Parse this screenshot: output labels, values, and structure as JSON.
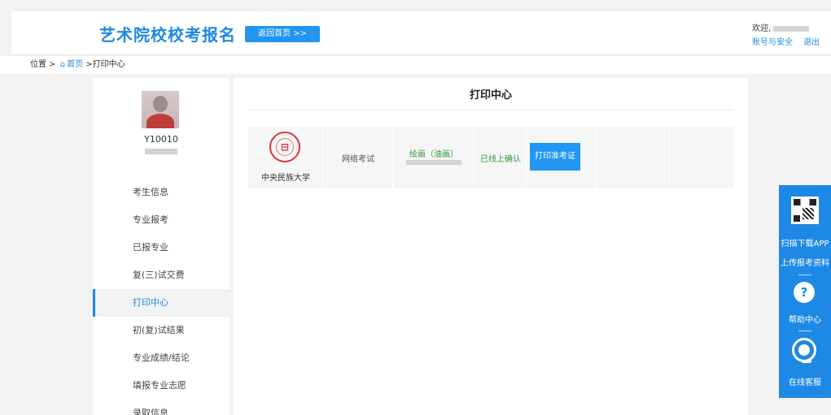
{
  "header": {
    "site_title": "艺术院校校考报名",
    "home_button": "返回首页 >>",
    "welcome": "欢迎,",
    "account_security": "账号与安全",
    "logout": "退出"
  },
  "breadcrumb": {
    "location": "位置 >",
    "home_icon": "⌂",
    "home": "首页",
    "separator": ">",
    "current": "打印中心"
  },
  "sidebar": {
    "student_id": "Y10010",
    "items": [
      {
        "label": "考生信息"
      },
      {
        "label": "专业报考"
      },
      {
        "label": "已报专业"
      },
      {
        "label": "复(三)试交费"
      },
      {
        "label": "打印中心"
      },
      {
        "label": "初(复)试结果"
      },
      {
        "label": "专业成绩/结论"
      },
      {
        "label": "填报专业志愿"
      },
      {
        "label": "录取信息"
      }
    ],
    "active_index": 4
  },
  "main": {
    "title": "打印中心",
    "row": {
      "university": "中央民族大学",
      "seal_glyph": "⊟",
      "exam_type": "网络考试",
      "major": "绘画（油画）",
      "status": "已线上确认",
      "print_button": "打印准考证"
    }
  },
  "float_panel": {
    "scan_text": "扫描下载APP",
    "upload_text": "上传报考资料",
    "help_icon": "?",
    "help_text": "帮助中心",
    "service_text": "在线客服"
  },
  "colors": {
    "accent": "#1e88e5",
    "button": "#2196f3",
    "success": "#2e9a3a",
    "seal": "#dd3333"
  }
}
